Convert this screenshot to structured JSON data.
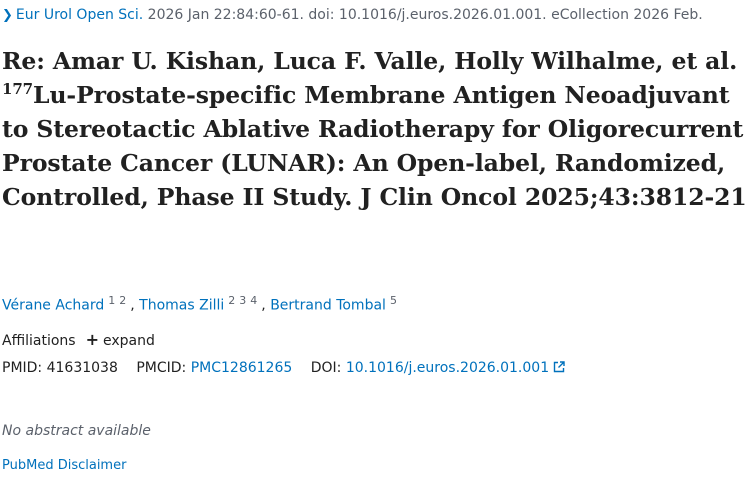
{
  "citation": {
    "journal": "Eur Urol Open Sci.",
    "details": "2026 Jan 22:84:60-61. doi: 10.1016/j.euros.2026.01.001. eCollection 2026 Feb."
  },
  "title": {
    "before_sup": "Re: Amar U. Kishan, Luca F. Valle, Holly Wilhalme, et al. ",
    "sup": "177",
    "after_sup": "Lu-Prostate-specific Membrane Antigen Neoadjuvant to Stereotactic Ablative Radiotherapy for Oligorecurrent Prostate Cancer (LUNAR): An Open-label, Randomized, Controlled, Phase II Study. J Clin Oncol 2025;43:3812-21"
  },
  "authors": [
    {
      "name": "Vérane Achard",
      "affs": [
        "1",
        "2"
      ]
    },
    {
      "name": "Thomas Zilli",
      "affs": [
        "2",
        "3",
        "4"
      ]
    },
    {
      "name": "Bertrand Tombal",
      "affs": [
        "5"
      ]
    }
  ],
  "affiliations": {
    "label": "Affiliations",
    "toggle_icon": "+",
    "toggle_label": "expand"
  },
  "ids": {
    "pmid_label": "PMID:",
    "pmid": "41631038",
    "pmcid_label": "PMCID:",
    "pmcid": "PMC12861265",
    "doi_label": "DOI:",
    "doi": "10.1016/j.euros.2026.01.001"
  },
  "abstract_note": "No abstract available",
  "disclaimer": "PubMed Disclaimer",
  "colors": {
    "link": "#0071bc",
    "text": "#212121",
    "muted": "#5b616b"
  }
}
